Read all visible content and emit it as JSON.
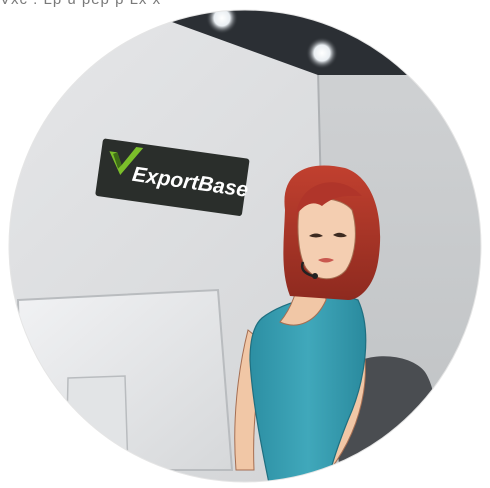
{
  "image": {
    "description_type": "illustration",
    "sign": {
      "brand": "ExportBase",
      "text_color": "#ffffff",
      "plate_color": "#2a2e2b",
      "logo_check_color": "#7bbf2a",
      "logo_check_dark": "#3f6e16"
    },
    "top_cropped_text": "Vxc . Lp u pep p Lx x",
    "colors": {
      "ceiling": "#2b2f34",
      "wall_left": "#d9dadc",
      "wall_right": "#c7c9cb",
      "hair": "#b0352a",
      "dress": "#3aa0b3",
      "skin": "#f1c7a6",
      "monitor": "#e7e8ea",
      "chair": "#4a4d51"
    }
  }
}
